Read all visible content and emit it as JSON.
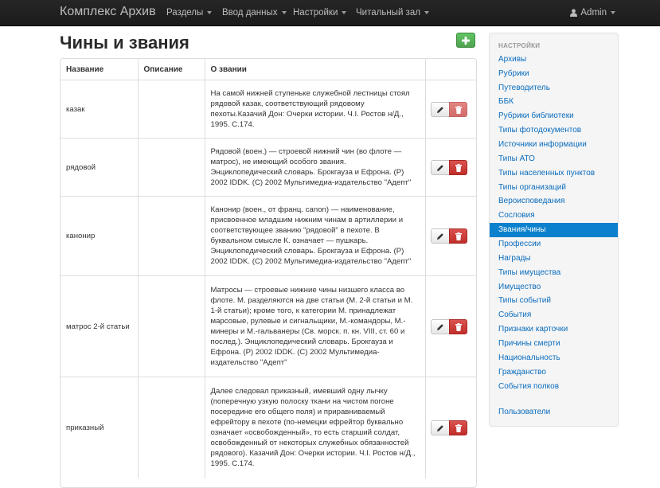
{
  "navbar": {
    "brand": "Комплекс Архив",
    "items": [
      {
        "label": "Разделы"
      },
      {
        "label": "Ввод данных"
      },
      {
        "label": "Настройки"
      },
      {
        "label": "Читальный зал"
      }
    ],
    "user": "Admin"
  },
  "page": {
    "title": "Чины и звания"
  },
  "table": {
    "headers": [
      "Название",
      "Описание",
      "О звании"
    ],
    "rows": [
      {
        "name": "казак",
        "description": "",
        "about": "На самой нижней ступеньке служебной лестницы стоял рядовой казак, соответствующий рядовому пехоты.Казачий Дон: Очерки истории. Ч.I. Ростов н/Д., 1995. С.174."
      },
      {
        "name": "рядовой",
        "description": "",
        "about": "Рядовой (воен.) — строевой нижний чин (во флоте — матрос), не имеющий особого звания. Энциклопедический словарь. Брокгауза и Ефрона. (Р) 2002 IDDK. (С) 2002 Мультимедиа-издательство \"Адепт\""
      },
      {
        "name": "канонир",
        "description": "",
        "about": "Канонир (воен., от франц. canon) — наименование, присвоенное младшим нижним чинам в артиллерии и соответствующее званию \"рядовой\" в пехоте. В буквальном смысле К. означает — пушкарь. Энциклопедический словарь. Брокгауза и Ефрона. (Р) 2002 IDDK. (С) 2002 Мультимедиа-издательство \"Адепт\""
      },
      {
        "name": "матрос 2-й статьи",
        "description": "",
        "about": "Матросы — строевые нижние чины низшего класса во флоте. М. разделяются на две статьи (М. 2-й статьи и М. 1-й статьи); кроме того, к категории М. принадлежат марсовые, рулевые и сигнальщики, М.-командоры, М.-минеры и М.-гальванеры (Св. морск. п. кн. VIII, ст. 60 и послед.). Энциклопедический словарь. Брокгауза и Ефрона. (Р) 2002 IDDK. (С) 2002 Мультимедиа-издательство \"Адепт\""
      },
      {
        "name": "приказный",
        "description": "",
        "about": "Далее следовал приказный, имевший одну лычку (поперечную узкую полоску ткани на чистом погоне посередине его общего поля) и приравниваемый ефрейтору в пехоте (по-немецки ефрейтор буквально означает «освобожденный», то есть старший солдат, освобожденный от некоторых служебных обязанностей рядового). Казачий Дон: Очерки истории. Ч.I. Ростов н/Д., 1995. С.174."
      }
    ]
  },
  "sidebar": {
    "header": "НАСТРОЙКИ",
    "items": [
      {
        "label": "Архивы"
      },
      {
        "label": "Рубрики"
      },
      {
        "label": "Путеводитель"
      },
      {
        "label": "ББК"
      },
      {
        "label": "Рубрики библиотеки"
      },
      {
        "label": "Типы фотодокументов"
      },
      {
        "label": "Источники информации"
      },
      {
        "label": "Типы АТО"
      },
      {
        "label": "Типы населенных пунктов"
      },
      {
        "label": "Типы организаций"
      },
      {
        "label": "Вероисповедания"
      },
      {
        "label": "Сословия"
      },
      {
        "label": "Звания/чины"
      },
      {
        "label": "Профессии"
      },
      {
        "label": "Награды"
      },
      {
        "label": "Типы имущества"
      },
      {
        "label": "Имущество"
      },
      {
        "label": "Типы событий"
      },
      {
        "label": "События"
      },
      {
        "label": "Признаки карточки"
      },
      {
        "label": "Причины смерти"
      },
      {
        "label": "Национальность"
      },
      {
        "label": "Гражданство"
      },
      {
        "label": "События полков"
      },
      {
        "label": "Пользователи"
      }
    ],
    "active": "Звания/чины"
  },
  "colors": {
    "navbar": "#1b1b1b",
    "link": "#0a6cbd",
    "active": "#0b80cc",
    "success": "#51a351",
    "danger": "#c12e2a"
  },
  "icons": {
    "add": "plus-icon",
    "edit": "pencil-icon",
    "delete": "trash-icon",
    "user": "user-icon"
  }
}
